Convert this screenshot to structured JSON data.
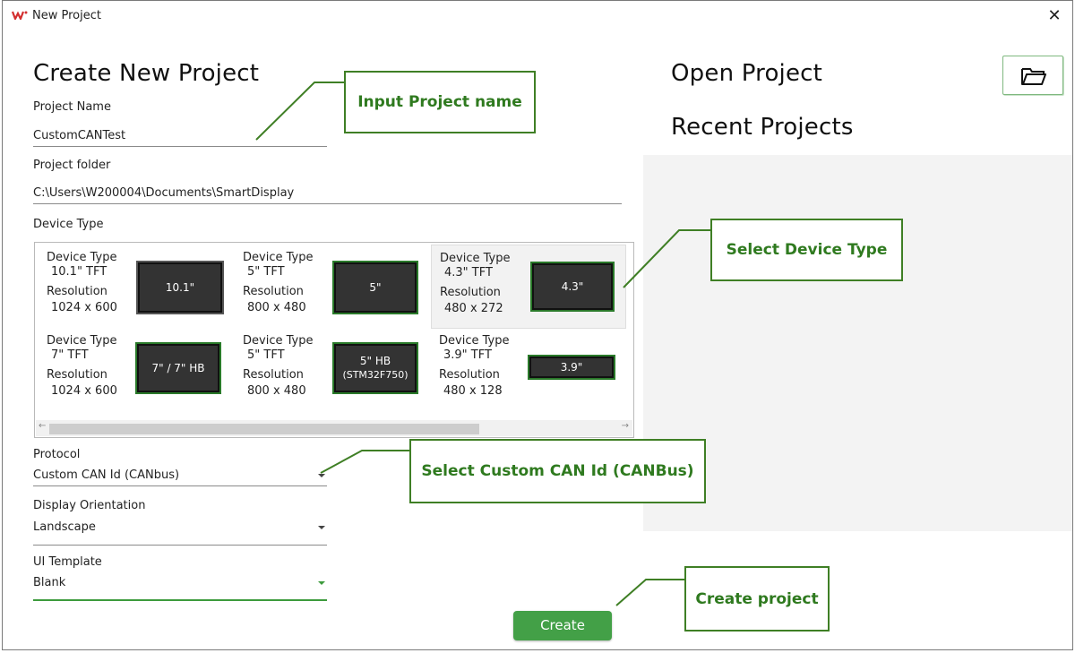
{
  "window": {
    "title": "New Project",
    "close_glyph": "✕"
  },
  "create_section": {
    "heading": "Create New Project",
    "project_name_label": "Project Name",
    "project_name_value": "CustomCANTest",
    "project_folder_label": "Project folder",
    "project_folder_value": "C:\\Users\\W200004\\Documents\\SmartDisplay",
    "device_type_label": "Device Type",
    "devices": [
      {
        "type_label": "Device Type",
        "type": "10.1\" TFT",
        "res_label": "Resolution",
        "resolution": "1024 x 600",
        "screen_text": "10.1\"",
        "selected": false
      },
      {
        "type_label": "Device Type",
        "type": "5\" TFT",
        "res_label": "Resolution",
        "resolution": "800 x 480",
        "screen_text": "5\"",
        "selected": false
      },
      {
        "type_label": "Device Type",
        "type": "4.3\" TFT",
        "res_label": "Resolution",
        "resolution": "480 x 272",
        "screen_text": "4.3\"",
        "selected": true
      },
      {
        "type_label": "Device Type",
        "type": "7\" TFT",
        "res_label": "Resolution",
        "resolution": "1024 x 600",
        "screen_text": "7\" / 7\" HB",
        "selected": false
      },
      {
        "type_label": "Device Type",
        "type": "5\" TFT",
        "res_label": "Resolution",
        "resolution": "800 x 480",
        "screen_text": "5\" HB",
        "screen_subtext": "(STM32F750)",
        "selected": false
      },
      {
        "type_label": "Device Type",
        "type": "3.9\" TFT",
        "res_label": "Resolution",
        "resolution": "480 x 128",
        "screen_text": "3.9\"",
        "selected": false
      }
    ],
    "protocol_label": "Protocol",
    "protocol_value": "Custom CAN Id (CANbus)",
    "orientation_label": "Display Orientation",
    "orientation_value": "Landscape",
    "template_label": "UI Template",
    "template_value": "Blank",
    "create_button": "Create"
  },
  "open_section": {
    "heading": "Open Project",
    "recent_heading": "Recent Projects",
    "open_folder_icon": "folder-open-icon"
  },
  "callouts": {
    "input_name": "Input Project name",
    "select_device": "Select Device Type",
    "select_protocol": "Select Custom CAN Id (CANBus)",
    "create": "Create project"
  },
  "colors": {
    "accent_green": "#43a047",
    "callout_green": "#3f7f25",
    "brand_red": "#d32f2f"
  }
}
